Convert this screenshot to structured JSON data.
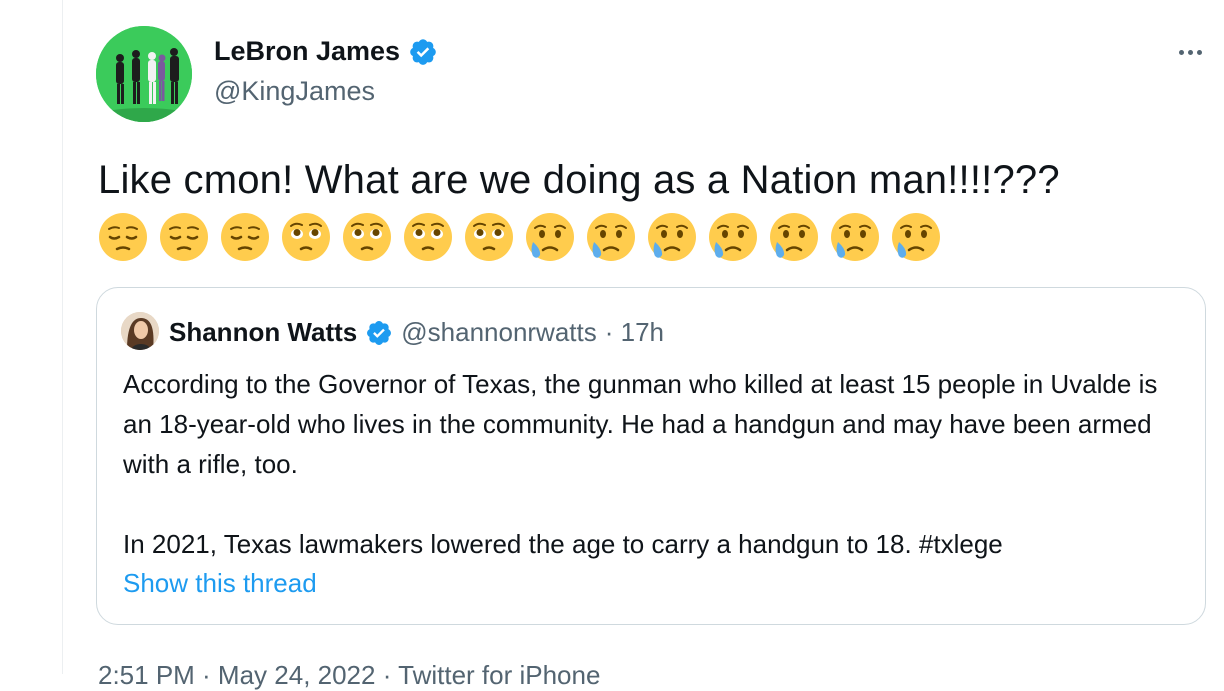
{
  "author": {
    "name": "LeBron James",
    "handle": "@KingJames",
    "verified": true
  },
  "tweet": {
    "text": "Like cmon! What are we doing as a Nation man!!!!???",
    "emojis": [
      "pensive",
      "pensive",
      "pensive",
      "pleading",
      "pleading",
      "pleading",
      "pleading",
      "crying",
      "crying",
      "crying",
      "crying",
      "crying",
      "crying",
      "crying"
    ]
  },
  "quoted_tweet": {
    "name": "Shannon Watts",
    "handle": "@shannonrwatts",
    "time": "· 17h",
    "paragraph1": "According to the Governor of Texas, the gunman who killed at least 15 people in Uvalde is an 18-year-old who lives in the community. He had a handgun and may have been armed with a rifle, too.",
    "paragraph2": "In 2021, Texas lawmakers lowered the age to carry a handgun to 18. #txlege",
    "show_thread": "Show this thread"
  },
  "timestamp": "2:51 PM · May 24, 2022 · Twitter for iPhone",
  "colors": {
    "accent": "#1d9bf0",
    "secondary_text": "#536471",
    "border": "#cfd9de"
  }
}
